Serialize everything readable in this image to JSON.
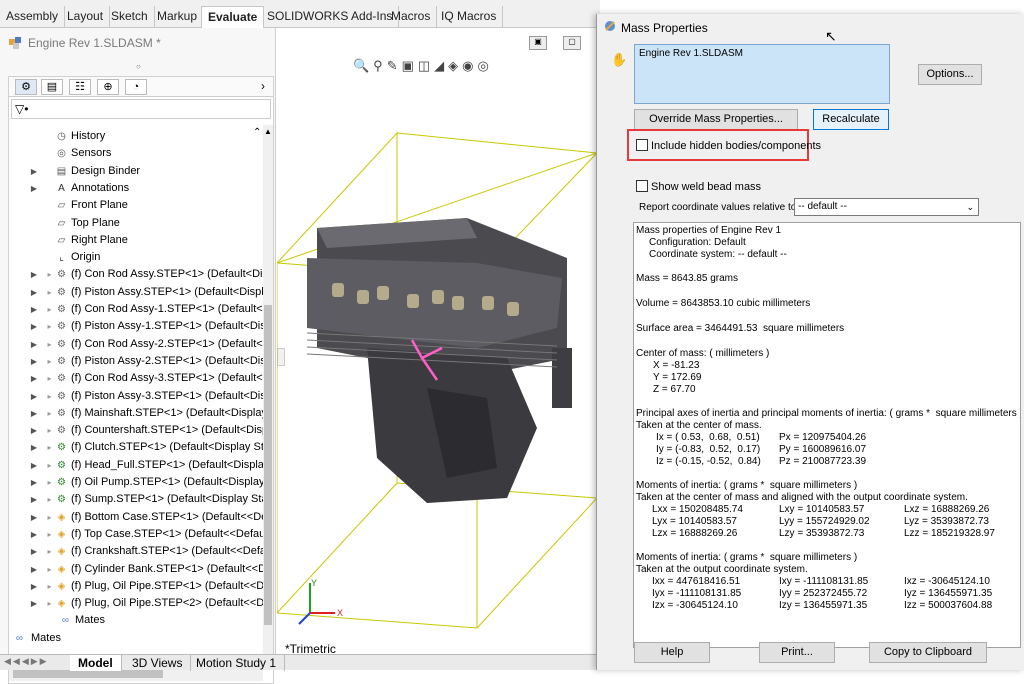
{
  "ribbon": {
    "tabs": [
      "Assembly",
      "Layout",
      "Sketch",
      "Markup",
      "Evaluate",
      "SOLIDWORKS Add-Ins",
      "Macros",
      "IQ Macros"
    ],
    "active": "Evaluate"
  },
  "document": {
    "title": "Engine Rev 1.SLDASM *"
  },
  "tree": {
    "items": [
      {
        "label": "History",
        "type": "hist",
        "arrow": false
      },
      {
        "label": "Sensors",
        "type": "sens",
        "arrow": false
      },
      {
        "label": "Design Binder",
        "type": "bind",
        "arrow": true
      },
      {
        "label": "Annotations",
        "type": "anno",
        "arrow": true
      },
      {
        "label": "Front Plane",
        "type": "plane",
        "arrow": false
      },
      {
        "label": "Top Plane",
        "type": "plane",
        "arrow": false
      },
      {
        "label": "Right Plane",
        "type": "plane",
        "arrow": false
      },
      {
        "label": "Origin",
        "type": "origin",
        "arrow": false
      },
      {
        "label": "(f) Con Rod Assy.STEP<1> (Default<Displa",
        "type": "comp",
        "arrow": true
      },
      {
        "label": "(f) Piston Assy.STEP<1> (Default<Display",
        "type": "comp",
        "arrow": true
      },
      {
        "label": "(f) Con Rod Assy-1.STEP<1> (Default<Dis",
        "type": "comp",
        "arrow": true
      },
      {
        "label": "(f) Piston Assy-1.STEP<1> (Default<Displa",
        "type": "comp",
        "arrow": true
      },
      {
        "label": "(f) Con Rod Assy-2.STEP<1> (Default<Dis",
        "type": "comp",
        "arrow": true
      },
      {
        "label": "(f) Piston Assy-2.STEP<1> (Default<Displa",
        "type": "comp",
        "arrow": true
      },
      {
        "label": "(f) Con Rod Assy-3.STEP<1> (Default<Dis",
        "type": "comp",
        "arrow": true
      },
      {
        "label": "(f) Piston Assy-3.STEP<1> (Default<Displa",
        "type": "comp",
        "arrow": true
      },
      {
        "label": "(f) Mainshaft.STEP<1> (Default<Display S",
        "type": "comp",
        "arrow": true
      },
      {
        "label": "(f) Countershaft.STEP<1> (Default<Displa",
        "type": "comp",
        "arrow": true
      },
      {
        "label": "(f) Clutch.STEP<1> (Default<Display State",
        "type": "compc",
        "arrow": true
      },
      {
        "label": "(f) Head_Full.STEP<1> (Default<Display S",
        "type": "compc",
        "arrow": true
      },
      {
        "label": "(f) Oil Pump.STEP<1> (Default<Display St",
        "type": "compc",
        "arrow": true
      },
      {
        "label": "(f) Sump.STEP<1> (Default<Display State",
        "type": "compc",
        "arrow": true
      },
      {
        "label": "(f) Bottom Case.STEP<1> (Default<<Defa",
        "type": "part",
        "arrow": true
      },
      {
        "label": "(f) Top Case.STEP<1> (Default<<Default>",
        "type": "part",
        "arrow": true
      },
      {
        "label": "(f) Crankshaft.STEP<1> (Default<<Default",
        "type": "part",
        "arrow": true
      },
      {
        "label": "(f) Cylinder Bank.STEP<1> (Default<<Defa",
        "type": "part",
        "arrow": true
      },
      {
        "label": "(f) Plug, Oil Pipe.STEP<1> (Default<<Defa",
        "type": "part",
        "arrow": true
      },
      {
        "label": "(f) Plug, Oil Pipe.STEP<2> (Default<<Defa",
        "type": "part",
        "arrow": true
      },
      {
        "label": "Mates",
        "type": "mates",
        "arrow": false
      }
    ],
    "root_mates": "Mates"
  },
  "bottom_tabs": [
    "Model",
    "3D Views",
    "Motion Study 1"
  ],
  "viewport": {
    "view_label": "*Trimetric",
    "axis_x": "X",
    "axis_y": "Y"
  },
  "dialog": {
    "title": "Mass Properties",
    "selection": "Engine Rev 1.SLDASM",
    "options_button": "Options...",
    "override_button": "Override Mass Properties...",
    "recalc_button": "Recalculate",
    "include_hidden": "Include hidden bodies/components",
    "show_weld": "Show weld bead mass",
    "report_label": "Report coordinate values relative to:",
    "report_value": "-- default --",
    "help_button": "Help",
    "print_button": "Print...",
    "copy_button": "Copy to Clipboard",
    "results": {
      "l1": "Mass properties of Engine Rev 1",
      "l2": "Configuration: Default",
      "l3": "Coordinate system: -- default --",
      "mass": "Mass = 8643.85 grams",
      "volume": "Volume = 8643853.10 cubic millimeters",
      "area": "Surface area = 3464491.53  square millimeters",
      "com_h": "Center of mass: ( millimeters )",
      "cx": "X = -81.23",
      "cy": "Y = 172.69",
      "cz": "Z = 67.70",
      "pa_h": "Principal axes of inertia and principal moments of inertia: ( grams *  square millimeters )",
      "pa_s": "Taken at the center of mass.",
      "ix": "Ix = ( 0.53,  0.68,  0.51)",
      "iy": "Iy = (-0.83,  0.52,  0.17)",
      "iz": "Iz = (-0.15, -0.52,  0.84)",
      "px": "Px = 120975404.26",
      "py": "Py = 160089616.07",
      "pz": "Pz = 210087723.39",
      "mc_h": "Moments of inertia: ( grams *  square millimeters )",
      "mc_s": "Taken at the center of mass and aligned with the output coordinate system.",
      "c11": "Lxx = 150208485.74",
      "c12": "Lxy = 10140583.57",
      "c13": "Lxz = 16888269.26",
      "c21": "Lyx = 10140583.57",
      "c22": "Lyy = 155724929.02",
      "c23": "Lyz = 35393872.73",
      "c31": "Lzx = 16888269.26",
      "c32": "Lzy = 35393872.73",
      "c33": "Lzz = 185219328.97",
      "mo_h": "Moments of inertia: ( grams *  square millimeters )",
      "mo_s": "Taken at the output coordinate system.",
      "o11": "Ixx = 447618416.51",
      "o12": "Ixy = -111108131.85",
      "o13": "Ixz = -30645124.10",
      "o21": "Iyx = -111108131.85",
      "o22": "Iyy = 252372455.72",
      "o23": "Iyz = 136455971.35",
      "o31": "Izx = -30645124.10",
      "o32": "Izy = 136455971.35",
      "o33": "Izz = 500037604.88"
    }
  },
  "colors": {
    "highlight_red": "#e8393a",
    "selection_bg": "#cce4f7",
    "accent": "#0078d7"
  }
}
